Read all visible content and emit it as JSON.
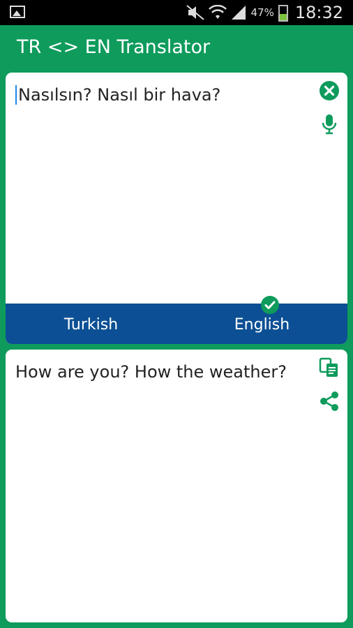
{
  "status_bar": {
    "battery_percent": "47%",
    "time": "18:32",
    "battery_level": 0.47,
    "icons": [
      "gallery-icon",
      "mute-icon",
      "wifi-icon",
      "signal-icon",
      "battery-icon"
    ]
  },
  "app": {
    "title": "TR <> EN Translator"
  },
  "source": {
    "text": "Nasılsın? Nasıl bir hava?",
    "icons": [
      "clear-icon",
      "microphone-icon"
    ]
  },
  "languages": {
    "from": "Turkish",
    "to": "English",
    "selected": "English"
  },
  "result": {
    "text": "How are you? How the weather?",
    "icons": [
      "copy-icon",
      "share-icon"
    ]
  },
  "colors": {
    "accent": "#0e9b5c",
    "language_bar": "#0c4f94",
    "status_bar": "#000000"
  }
}
